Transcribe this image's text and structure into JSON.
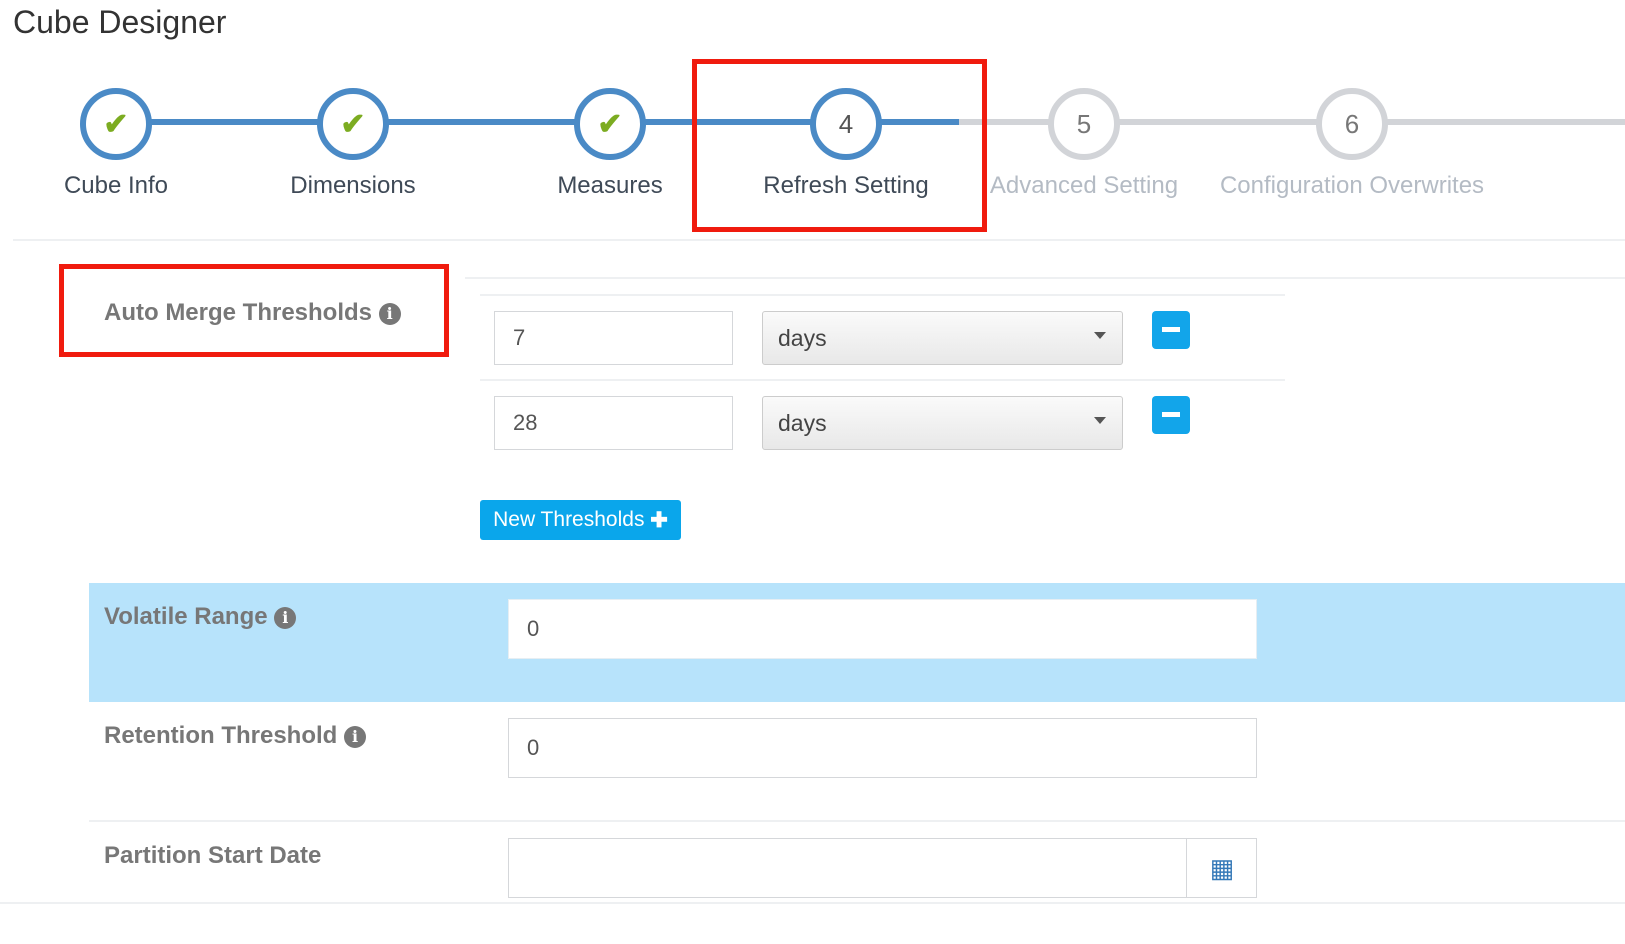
{
  "title": "Cube Designer",
  "steps": [
    {
      "label": "Cube Info",
      "state": "done",
      "icon": "check-icon"
    },
    {
      "label": "Dimensions",
      "state": "done",
      "icon": "check-icon"
    },
    {
      "label": "Measures",
      "state": "done",
      "icon": "check-icon"
    },
    {
      "label": "Refresh Setting",
      "number": "4",
      "state": "current"
    },
    {
      "label": "Advanced Setting",
      "number": "5",
      "state": "pending"
    },
    {
      "label": "Configuration Overwrites",
      "number": "6",
      "state": "pending"
    }
  ],
  "auto_merge": {
    "label": "Auto Merge Thresholds",
    "rows": [
      {
        "value": "7",
        "unit": "days"
      },
      {
        "value": "28",
        "unit": "days"
      }
    ],
    "new_button": "New Thresholds"
  },
  "volatile_range": {
    "label": "Volatile Range",
    "value": "0"
  },
  "retention_threshold": {
    "label": "Retention Threshold",
    "value": "0"
  },
  "partition_start_date": {
    "label": "Partition Start Date",
    "value": ""
  },
  "colors": {
    "accent": "#4a8ac6",
    "highlight": "#f01b0e",
    "button": "#0aa6eb",
    "band": "#b7e3fb",
    "check": "#7cac21"
  }
}
